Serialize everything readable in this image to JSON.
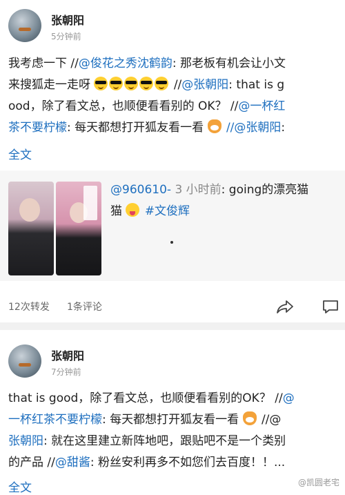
{
  "post1": {
    "username": "张朝阳",
    "time": "5分钟前",
    "line1": [
      "我考虑一下 //",
      "@俊花之秀沈鹤韵",
      ": 那老板有机会让小文"
    ],
    "line2": "来搜狐走一走呀",
    "line2_mention": "@张朝阳",
    "line2_tail": ": that is g",
    "line3a": "ood，除了看文总，也顺便看看别的 OK？ //",
    "line3_mention": "@一杯红",
    "line4a": "茶不要柠檬",
    "line4b": ": 每天都想打开狐友看一看",
    "line4_mention": "//@张朝阳",
    "line4_tail": ":",
    "more": "全文",
    "repost": {
      "author_mention": "@960610-",
      "time": "3 小时前",
      "text_a": ": going的漂亮猫",
      "text_b": "猫",
      "hashtag": "#文俊辉"
    },
    "repost_count": "12次转发",
    "comment_count": "1条评论"
  },
  "post2": {
    "username": "张朝阳",
    "time": "7分钟前",
    "line1a": "that is good，除了看文总，也顺便看看别的OK？ //",
    "line1_mention": "@",
    "line2_mention": "一杯红茶不要柠檬",
    "line2b": ": 每天都想打开狐友看一看",
    "line2c": "//@",
    "line3_mention": "张朝阳",
    "line3b": ": 就在这里建立新阵地吧，跟贴吧不是一个类别",
    "line4a": "的产品 //",
    "line4_mention": "@甜酱",
    "line4b": ": 粉丝安利再多不如您们去百度！！...",
    "more": "全文"
  },
  "watermark": "@凯圆老宅",
  "icons": {
    "sunglasses": "sunglasses-emoji",
    "fox": "fox-emoji",
    "tongue": "tongue-out-emoji",
    "share": "share-icon",
    "comment": "comment-icon"
  },
  "colors": {
    "link": "#1e6fbf",
    "text": "#222222",
    "meta": "#999999",
    "repost_bg": "#f6f6f6"
  }
}
